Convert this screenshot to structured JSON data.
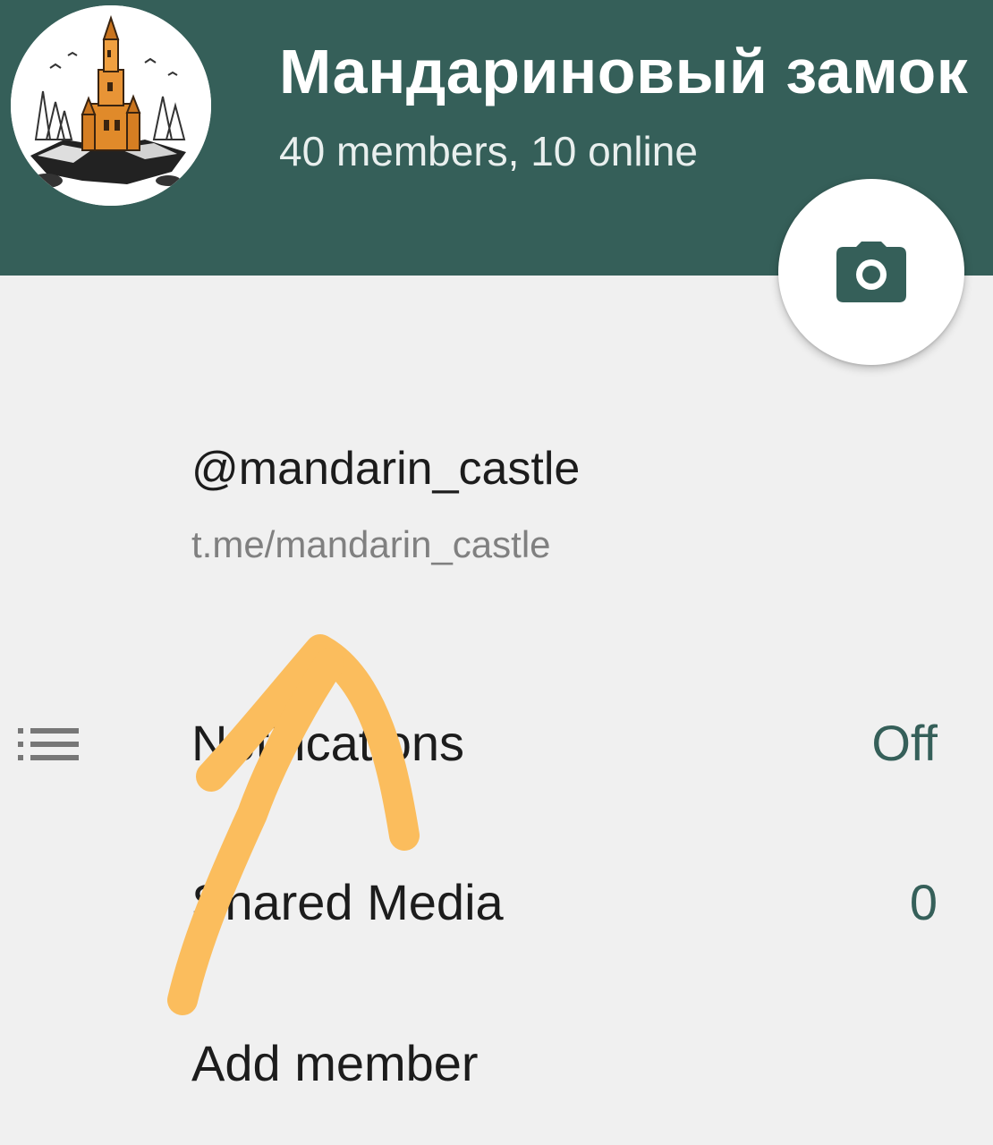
{
  "header": {
    "title": "Мандариновый замок",
    "subtitle": "40 members, 10 online",
    "background_color": "#355f59",
    "camera_button_icon": "camera-icon"
  },
  "profile": {
    "username": "@mandarin_castle",
    "link": "t.me/mandarin_castle"
  },
  "rows": {
    "notifications": {
      "icon": "list-icon",
      "label": "Notifications",
      "value": "Off"
    },
    "shared_media": {
      "label": "Shared Media",
      "value": "0"
    },
    "add_member": {
      "label": "Add member"
    }
  },
  "accent_color": "#355f59",
  "annotation_color": "#fbbd5d"
}
